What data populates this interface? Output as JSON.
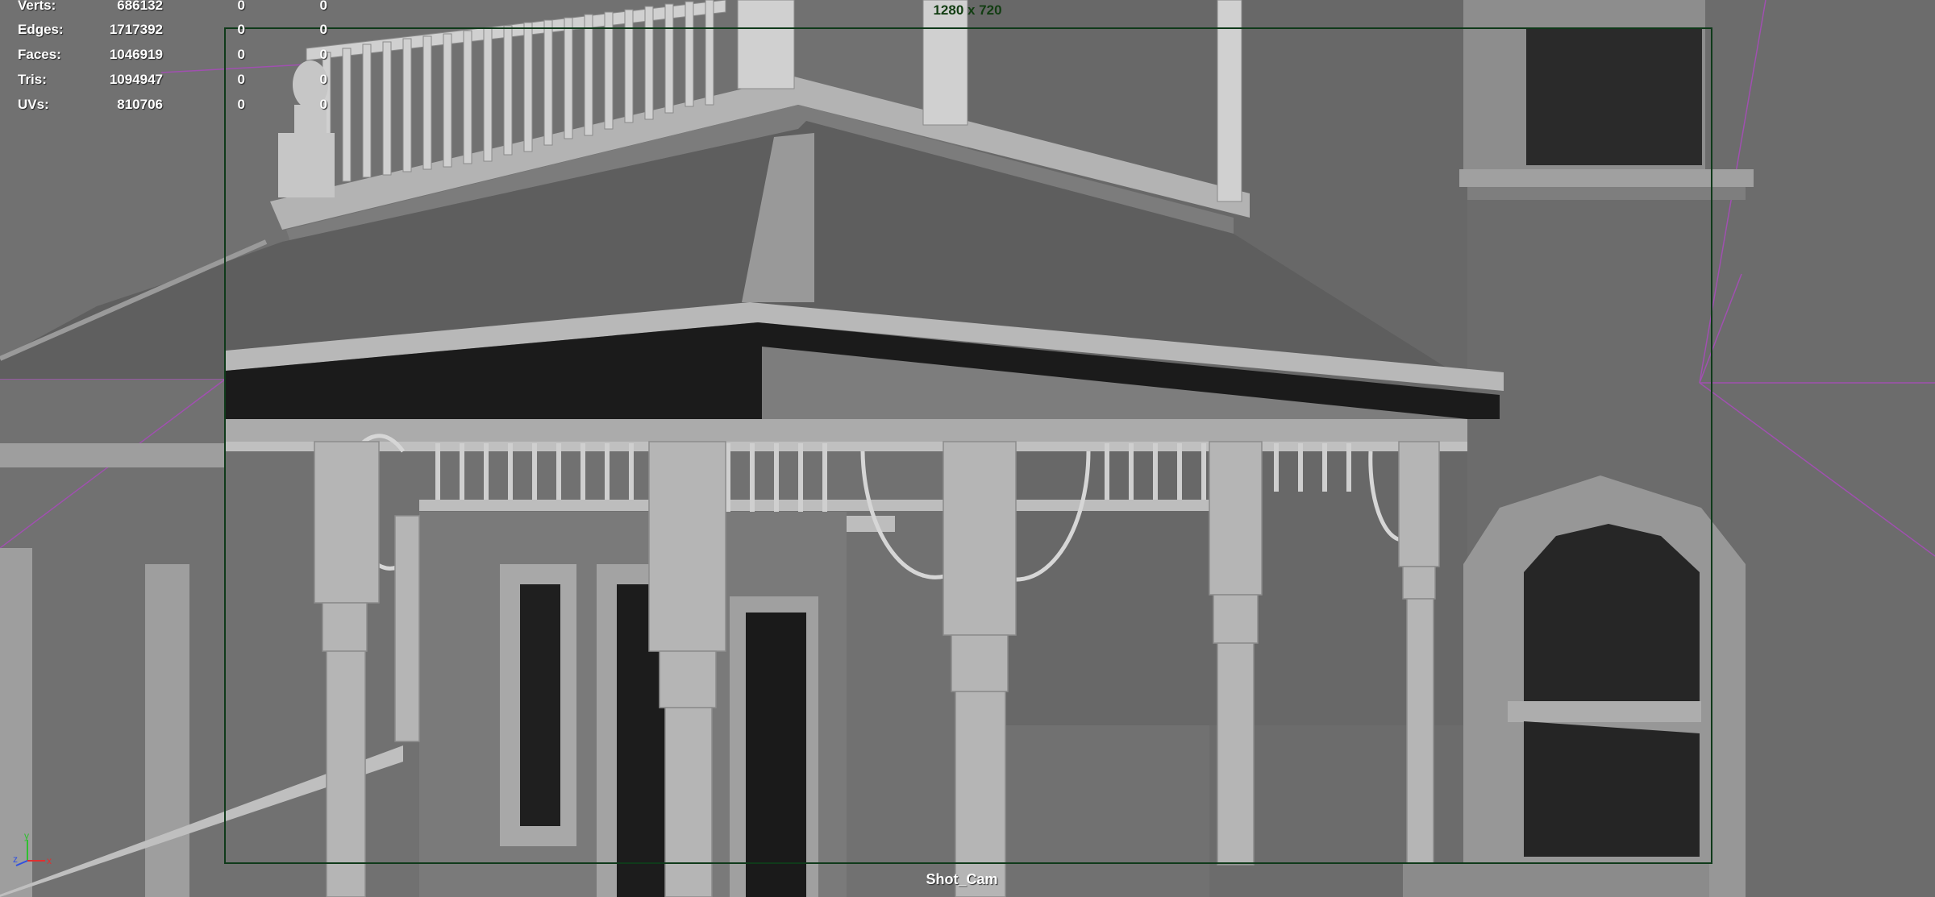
{
  "hud": {
    "rows": [
      {
        "label": "Verts:",
        "total": "686132",
        "selected": "0",
        "component": "0"
      },
      {
        "label": "Edges:",
        "total": "1717392",
        "selected": "0",
        "component": "0"
      },
      {
        "label": "Faces:",
        "total": "1046919",
        "selected": "0",
        "component": "0"
      },
      {
        "label": "Tris:",
        "total": "1094947",
        "selected": "0",
        "component": "0"
      },
      {
        "label": "UVs:",
        "total": "810706",
        "selected": "0",
        "component": "0"
      }
    ]
  },
  "viewport": {
    "resolution_label": "1280 x 720",
    "camera_name": "Shot_Cam"
  },
  "axis": {
    "y_label": "y",
    "z_label": "z",
    "x_label": "x"
  },
  "colors": {
    "gate_border": "#0f3a1a",
    "resolution_text": "#123d12",
    "camera_guides": "#a050b0",
    "axis_x": "#e03030",
    "axis_y": "#30c030",
    "axis_z": "#3050e0"
  }
}
